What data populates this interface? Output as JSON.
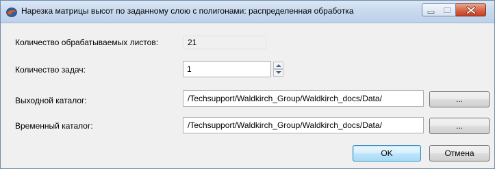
{
  "window": {
    "title": "Нарезка матрицы высот по заданному слою с полигонами: распределенная обработка"
  },
  "form": {
    "sheets_label": "Количество обрабатываемых листов:",
    "sheets_value": "21",
    "tasks_label": "Количество задач:",
    "tasks_value": "1",
    "output_label": "Выходной каталог:",
    "output_value": "/Techsupport/Waldkirch_Group/Waldkirch_docs/Data/",
    "temp_label": "Временный каталог:",
    "temp_value": "/Techsupport/Waldkirch_Group/Waldkirch_docs/Data/",
    "browse_label": "..."
  },
  "buttons": {
    "ok": "OK",
    "cancel": "Отмена"
  }
}
